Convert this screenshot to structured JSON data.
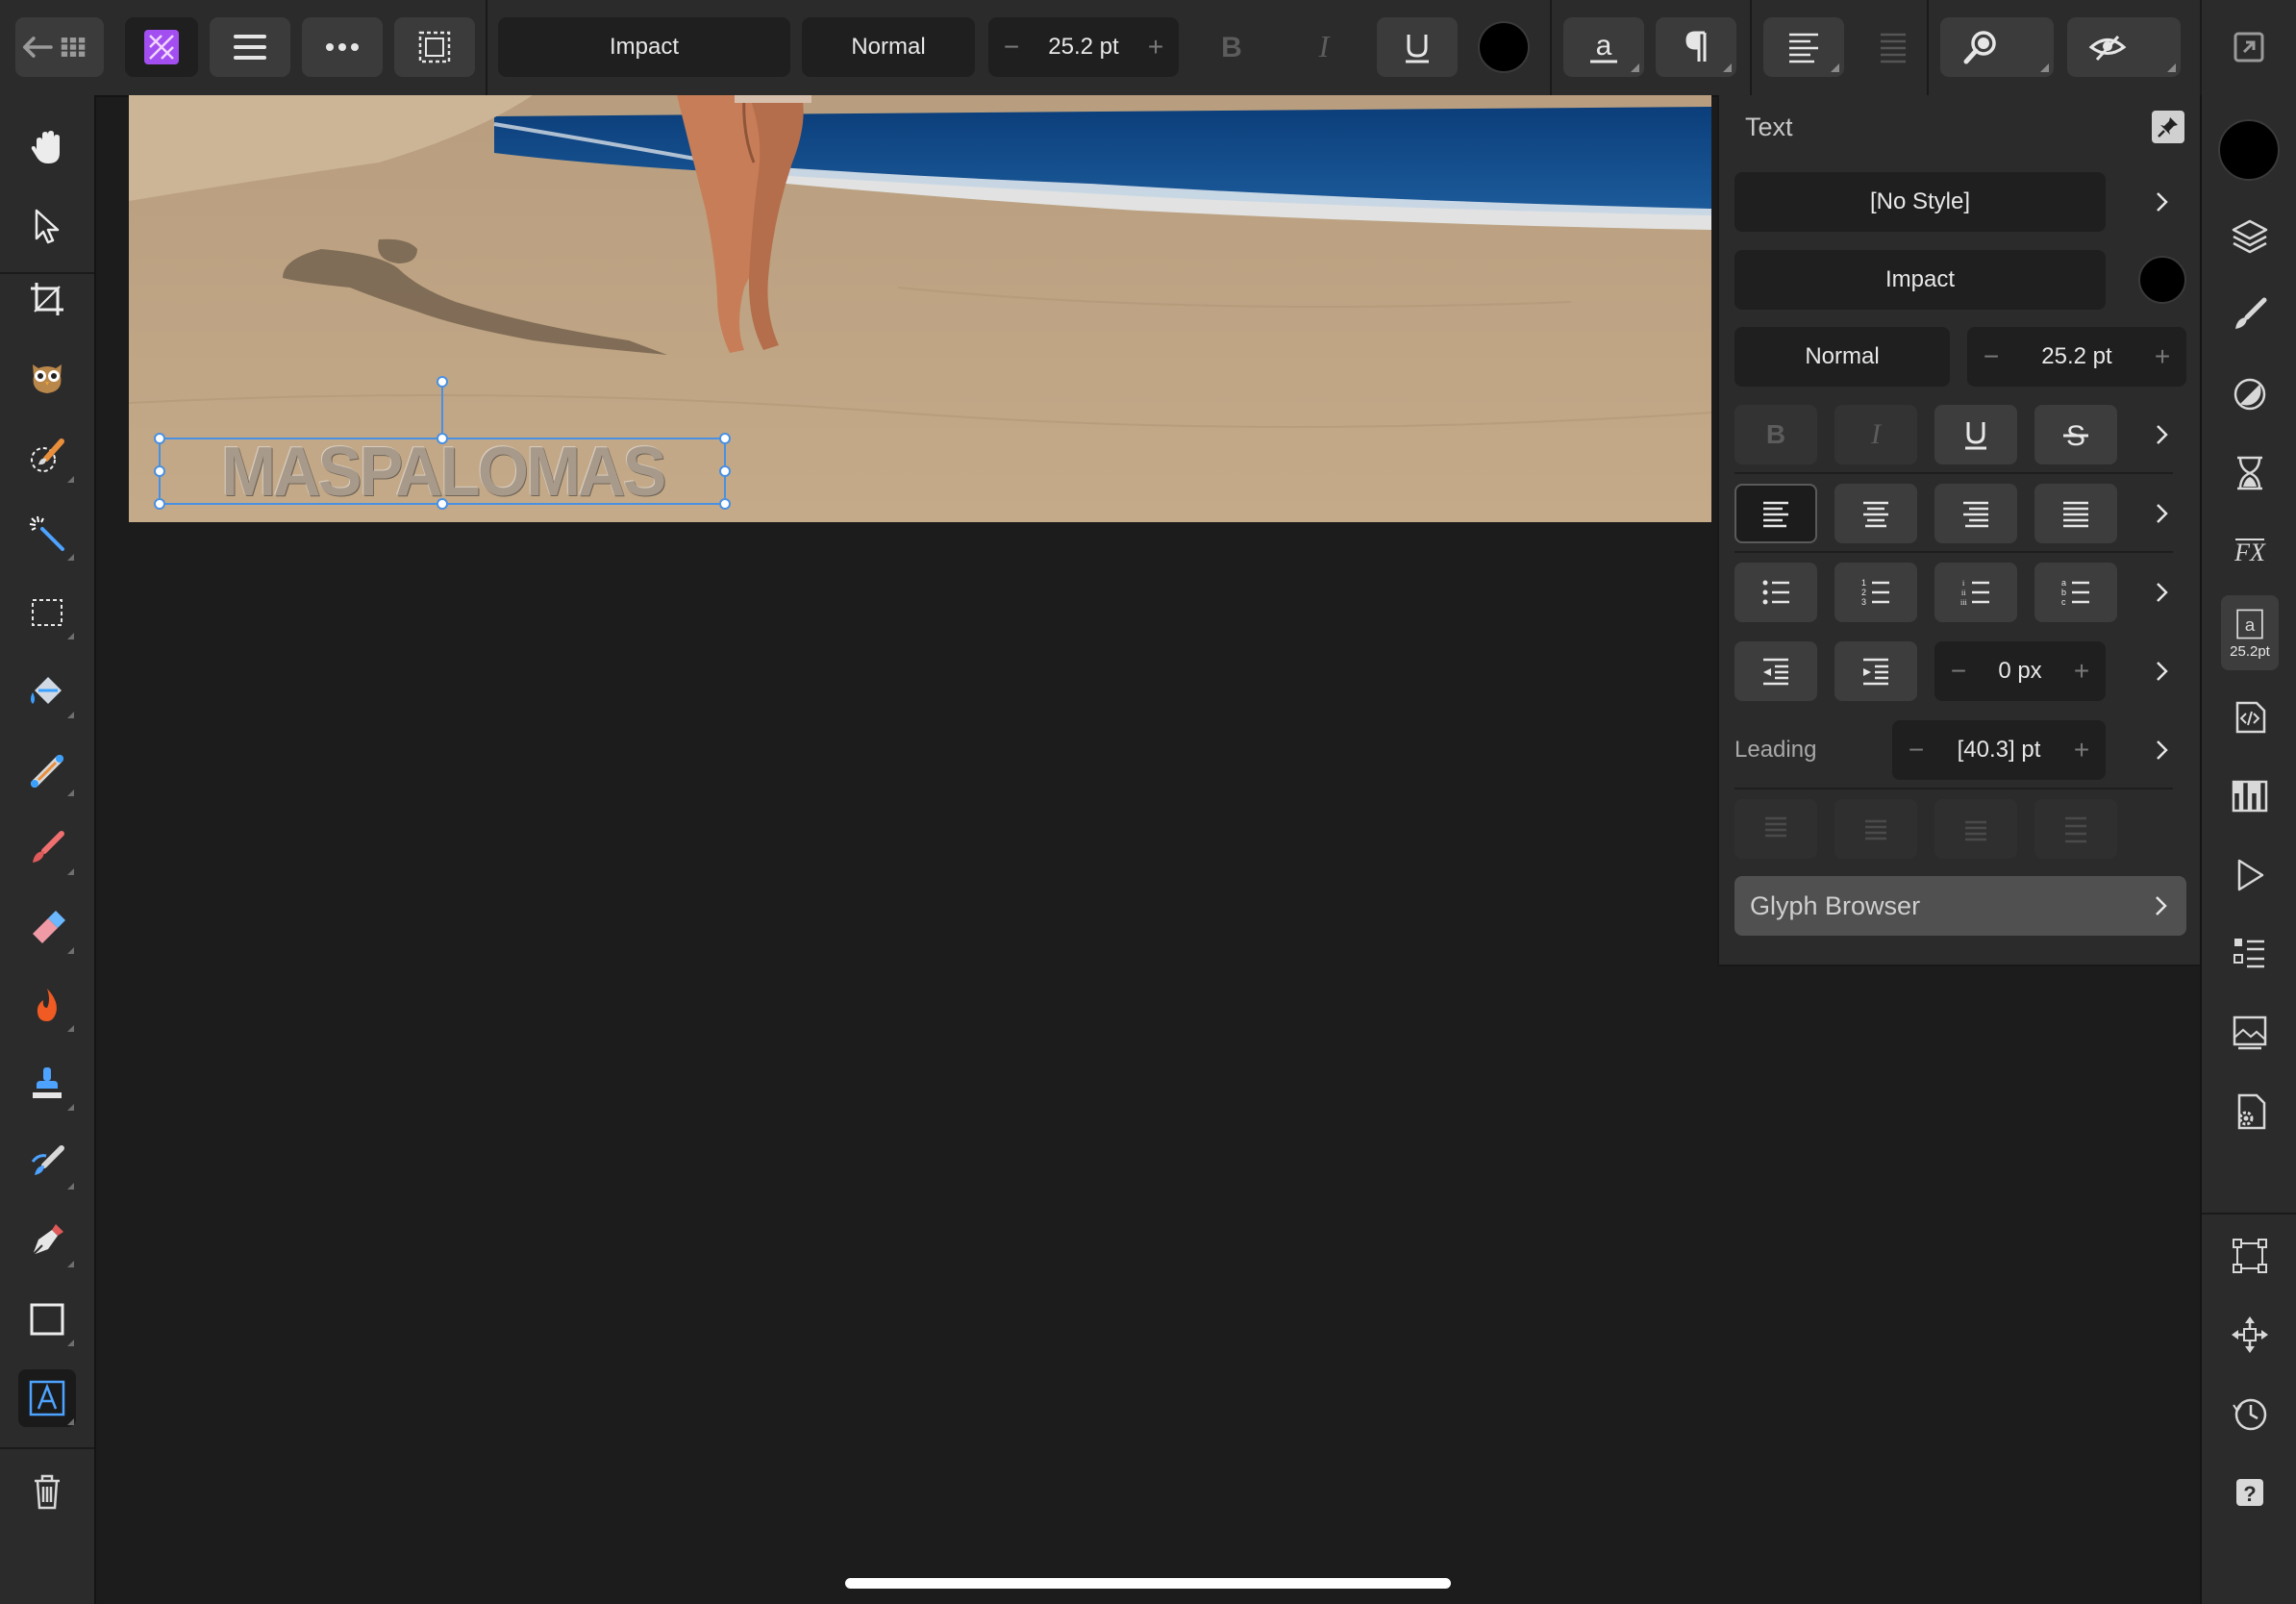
{
  "topbar": {
    "font_name": "Impact",
    "font_style": "Normal",
    "font_size": "25.2 pt",
    "minus": "−",
    "plus": "+",
    "text_color": "#000000"
  },
  "canvas": {
    "text_layer": "MASPALOMAS"
  },
  "text_panel": {
    "title": "Text",
    "style": "[No Style]",
    "font_name": "Impact",
    "font_style": "Normal",
    "font_size": "25.2 pt",
    "indent_value": "0 px",
    "leading_label": "Leading",
    "leading_value": "[40.3] pt",
    "glyph_browser": "Glyph Browser",
    "text_color": "#000000",
    "minus": "−",
    "plus": "+"
  },
  "studio": {
    "color_swatch": "#000000",
    "text_panel_badge": "25.2pt"
  },
  "colors": {
    "accent": "#4a90e2",
    "app_icon": "#a24ef0",
    "selection_handle": "#4a90e2"
  }
}
